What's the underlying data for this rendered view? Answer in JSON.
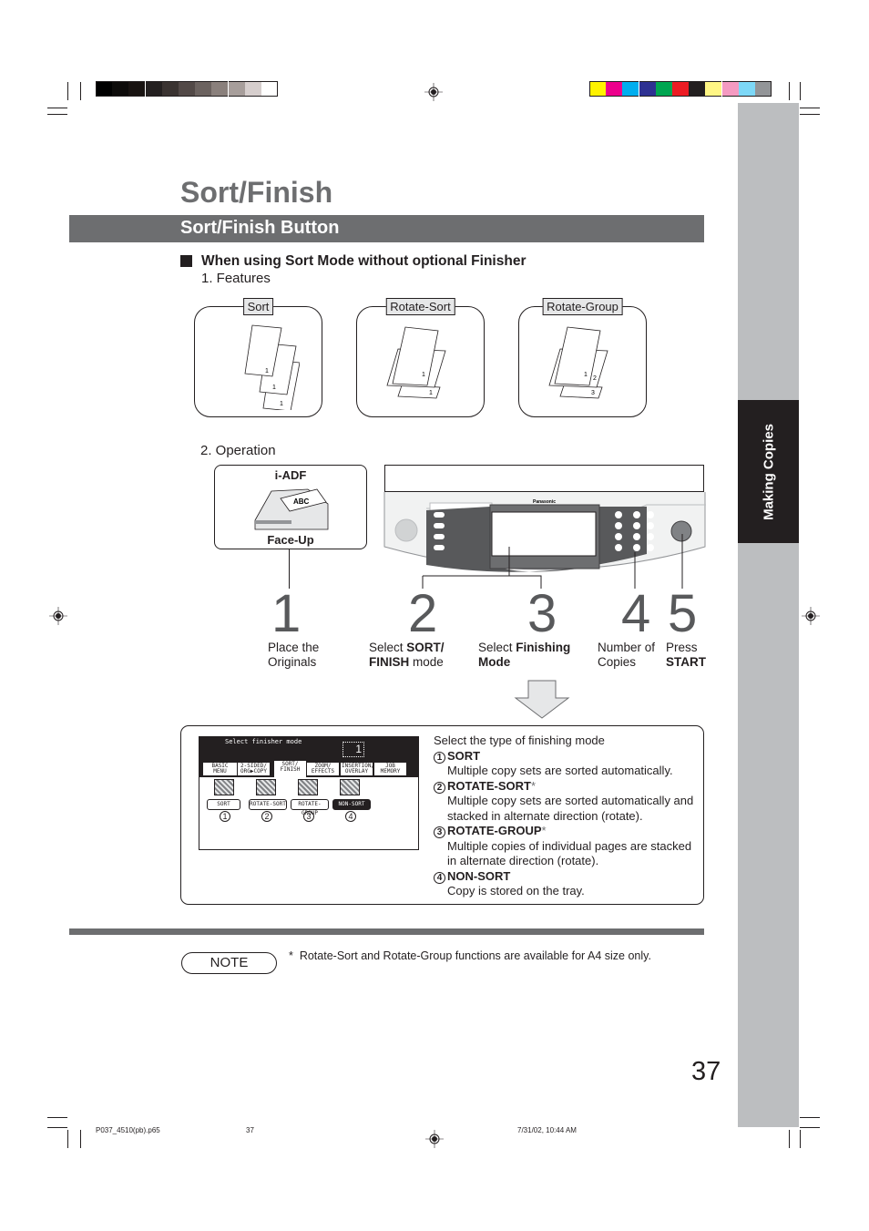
{
  "print_marks": {
    "gray_swatches": [
      "#000000",
      "#0d0b0a",
      "#181311",
      "#242020",
      "#3a3331",
      "#524947",
      "#6b625f",
      "#8a807c",
      "#a79e9b",
      "#d6cecd",
      "#ffffff"
    ],
    "color_swatches": [
      "#fff200",
      "#ec008c",
      "#00aeef",
      "#2e3192",
      "#00a651",
      "#ed1c24",
      "#231f20",
      "#fff685",
      "#f49ac1",
      "#7dd8f7",
      "#939598"
    ]
  },
  "side_tab": {
    "label": "Making Copies",
    "color": "#231f20",
    "strip_color": "#bcbec0"
  },
  "page_title": "Sort/Finish",
  "section_banner": "Sort/Finish Button",
  "subheading": "When using Sort Mode without optional Finisher",
  "features": {
    "label": "1. Features",
    "items": [
      {
        "label": "Sort"
      },
      {
        "label": "Rotate-Sort"
      },
      {
        "label": "Rotate-Group"
      }
    ]
  },
  "operation": {
    "label": "2. Operation",
    "adf_label": "i-ADF",
    "adf_sub": "Face-Up",
    "adf_paper_text": "ABC",
    "panel_brand": "Panasonic",
    "steps": [
      {
        "num": "1",
        "line1": "Place the",
        "line2": "Originals",
        "bold1": "",
        "bold2": ""
      },
      {
        "num": "2",
        "line1": "Select ",
        "bold1": "SORT/",
        "bold2": "FINISH",
        "line2": " mode"
      },
      {
        "num": "3",
        "line1": "Select ",
        "bold1": "Finishing",
        "bold2": "Mode",
        "line2": ""
      },
      {
        "num": "4",
        "line1": "Number of",
        "line2": "Copies",
        "bold1": "",
        "bold2": ""
      },
      {
        "num": "5",
        "line1": "Press",
        "bold2": "START",
        "line2": "",
        "bold1": ""
      }
    ]
  },
  "lcd": {
    "prompt": "Select finisher mode",
    "count": "1",
    "tabs": [
      "BASIC MENU",
      "2-SIDED/ ORG▶COPY",
      "SORT/ FINISH",
      "ZOOM/ EFFECTS",
      "INSERTION/ OVERLAY",
      "JOB MEMORY"
    ],
    "modes": [
      {
        "label": "SORT",
        "num": "1"
      },
      {
        "label": "ROTATE-SORT",
        "num": "2"
      },
      {
        "label": "ROTATE-GROUP",
        "num": "3"
      },
      {
        "label": "NON-SORT",
        "num": "4",
        "selected": true
      }
    ]
  },
  "description": {
    "intro": "Select the type of finishing mode",
    "items": [
      {
        "num": "1",
        "title": "SORT",
        "mark": "",
        "lines": [
          "Multiple copy sets are sorted automatically."
        ]
      },
      {
        "num": "2",
        "title": "ROTATE-SORT",
        "mark": "*",
        "lines": [
          "Multiple copy sets are sorted automatically and",
          "stacked in alternate direction (rotate)."
        ]
      },
      {
        "num": "3",
        "title": "ROTATE-GROUP",
        "mark": "*",
        "lines": [
          "Multiple copies of individual pages are stacked",
          "in alternate direction (rotate)."
        ]
      },
      {
        "num": "4",
        "title": "NON-SORT",
        "mark": "",
        "lines": [
          "Copy is stored on the tray."
        ]
      }
    ]
  },
  "note": {
    "label": "NOTE",
    "mark": "*",
    "text": "Rotate-Sort and Rotate-Group functions are available for A4 size only."
  },
  "page_number": "37",
  "footer": {
    "file": "P037_4510(pb).p65",
    "page": "37",
    "timestamp": "7/31/02, 10:44 AM"
  }
}
